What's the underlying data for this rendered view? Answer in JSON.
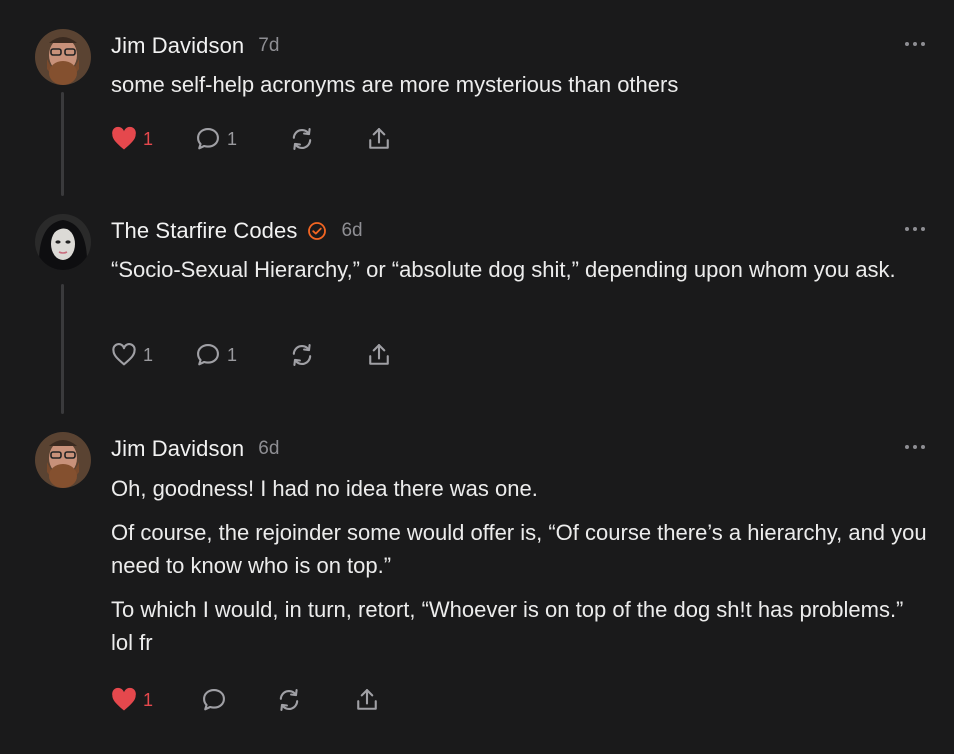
{
  "comments": [
    {
      "author": "Jim Davidson",
      "time": "7d",
      "verified": false,
      "paragraphs": [
        "some self-help acronyms are more mysterious than others"
      ],
      "likes": "1",
      "liked": true,
      "replies": "1"
    },
    {
      "author": "The Starfire Codes",
      "time": "6d",
      "verified": true,
      "paragraphs": [
        "“Socio-Sexual Hierarchy,” or “absolute dog shit,” depending upon whom you ask."
      ],
      "likes": "1",
      "liked": false,
      "replies": "1"
    },
    {
      "author": "Jim Davidson",
      "time": "6d",
      "verified": false,
      "paragraphs": [
        "Oh, goodness! I had no idea there was one.",
        "Of course, the rejoinder some would offer is, “Of course there’s a hierarchy, and you need to know who is on top.”",
        "To which I would, in turn, retort, “Whoever is on top of the dog sh!t has problems.” lol fr"
      ],
      "likes": "1",
      "liked": true,
      "replies": ""
    }
  ],
  "icons": {
    "like": "heart-icon",
    "reply": "comment-bubble-icon",
    "restack": "restack-icon",
    "share": "share-icon",
    "more": "more-dots-icon",
    "verified": "verified-check-icon"
  },
  "colors": {
    "background": "#1a1a1b",
    "text": "#ececec",
    "muted": "#8e8e93",
    "like_active": "#e5484d",
    "verified": "#f26522",
    "thread_line": "#3a3a3c"
  }
}
